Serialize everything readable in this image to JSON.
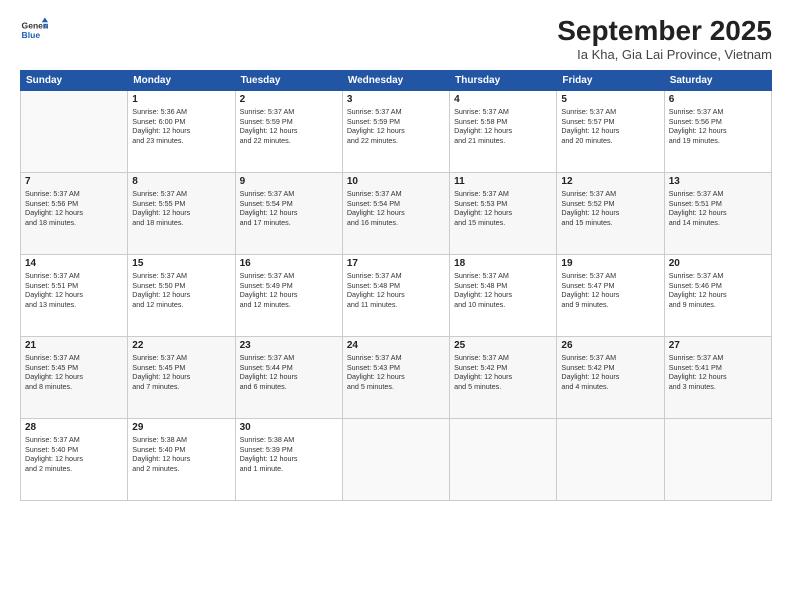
{
  "header": {
    "logo_line1": "General",
    "logo_line2": "Blue",
    "month": "September 2025",
    "location": "Ia Kha, Gia Lai Province, Vietnam"
  },
  "days_of_week": [
    "Sunday",
    "Monday",
    "Tuesday",
    "Wednesday",
    "Thursday",
    "Friday",
    "Saturday"
  ],
  "weeks": [
    [
      {
        "num": "",
        "info": ""
      },
      {
        "num": "1",
        "info": "Sunrise: 5:36 AM\nSunset: 6:00 PM\nDaylight: 12 hours\nand 23 minutes."
      },
      {
        "num": "2",
        "info": "Sunrise: 5:37 AM\nSunset: 5:59 PM\nDaylight: 12 hours\nand 22 minutes."
      },
      {
        "num": "3",
        "info": "Sunrise: 5:37 AM\nSunset: 5:59 PM\nDaylight: 12 hours\nand 22 minutes."
      },
      {
        "num": "4",
        "info": "Sunrise: 5:37 AM\nSunset: 5:58 PM\nDaylight: 12 hours\nand 21 minutes."
      },
      {
        "num": "5",
        "info": "Sunrise: 5:37 AM\nSunset: 5:57 PM\nDaylight: 12 hours\nand 20 minutes."
      },
      {
        "num": "6",
        "info": "Sunrise: 5:37 AM\nSunset: 5:56 PM\nDaylight: 12 hours\nand 19 minutes."
      }
    ],
    [
      {
        "num": "7",
        "info": "Sunrise: 5:37 AM\nSunset: 5:56 PM\nDaylight: 12 hours\nand 18 minutes."
      },
      {
        "num": "8",
        "info": "Sunrise: 5:37 AM\nSunset: 5:55 PM\nDaylight: 12 hours\nand 18 minutes."
      },
      {
        "num": "9",
        "info": "Sunrise: 5:37 AM\nSunset: 5:54 PM\nDaylight: 12 hours\nand 17 minutes."
      },
      {
        "num": "10",
        "info": "Sunrise: 5:37 AM\nSunset: 5:54 PM\nDaylight: 12 hours\nand 16 minutes."
      },
      {
        "num": "11",
        "info": "Sunrise: 5:37 AM\nSunset: 5:53 PM\nDaylight: 12 hours\nand 15 minutes."
      },
      {
        "num": "12",
        "info": "Sunrise: 5:37 AM\nSunset: 5:52 PM\nDaylight: 12 hours\nand 15 minutes."
      },
      {
        "num": "13",
        "info": "Sunrise: 5:37 AM\nSunset: 5:51 PM\nDaylight: 12 hours\nand 14 minutes."
      }
    ],
    [
      {
        "num": "14",
        "info": "Sunrise: 5:37 AM\nSunset: 5:51 PM\nDaylight: 12 hours\nand 13 minutes."
      },
      {
        "num": "15",
        "info": "Sunrise: 5:37 AM\nSunset: 5:50 PM\nDaylight: 12 hours\nand 12 minutes."
      },
      {
        "num": "16",
        "info": "Sunrise: 5:37 AM\nSunset: 5:49 PM\nDaylight: 12 hours\nand 12 minutes."
      },
      {
        "num": "17",
        "info": "Sunrise: 5:37 AM\nSunset: 5:48 PM\nDaylight: 12 hours\nand 11 minutes."
      },
      {
        "num": "18",
        "info": "Sunrise: 5:37 AM\nSunset: 5:48 PM\nDaylight: 12 hours\nand 10 minutes."
      },
      {
        "num": "19",
        "info": "Sunrise: 5:37 AM\nSunset: 5:47 PM\nDaylight: 12 hours\nand 9 minutes."
      },
      {
        "num": "20",
        "info": "Sunrise: 5:37 AM\nSunset: 5:46 PM\nDaylight: 12 hours\nand 9 minutes."
      }
    ],
    [
      {
        "num": "21",
        "info": "Sunrise: 5:37 AM\nSunset: 5:45 PM\nDaylight: 12 hours\nand 8 minutes."
      },
      {
        "num": "22",
        "info": "Sunrise: 5:37 AM\nSunset: 5:45 PM\nDaylight: 12 hours\nand 7 minutes."
      },
      {
        "num": "23",
        "info": "Sunrise: 5:37 AM\nSunset: 5:44 PM\nDaylight: 12 hours\nand 6 minutes."
      },
      {
        "num": "24",
        "info": "Sunrise: 5:37 AM\nSunset: 5:43 PM\nDaylight: 12 hours\nand 5 minutes."
      },
      {
        "num": "25",
        "info": "Sunrise: 5:37 AM\nSunset: 5:42 PM\nDaylight: 12 hours\nand 5 minutes."
      },
      {
        "num": "26",
        "info": "Sunrise: 5:37 AM\nSunset: 5:42 PM\nDaylight: 12 hours\nand 4 minutes."
      },
      {
        "num": "27",
        "info": "Sunrise: 5:37 AM\nSunset: 5:41 PM\nDaylight: 12 hours\nand 3 minutes."
      }
    ],
    [
      {
        "num": "28",
        "info": "Sunrise: 5:37 AM\nSunset: 5:40 PM\nDaylight: 12 hours\nand 2 minutes."
      },
      {
        "num": "29",
        "info": "Sunrise: 5:38 AM\nSunset: 5:40 PM\nDaylight: 12 hours\nand 2 minutes."
      },
      {
        "num": "30",
        "info": "Sunrise: 5:38 AM\nSunset: 5:39 PM\nDaylight: 12 hours\nand 1 minute."
      },
      {
        "num": "",
        "info": ""
      },
      {
        "num": "",
        "info": ""
      },
      {
        "num": "",
        "info": ""
      },
      {
        "num": "",
        "info": ""
      }
    ]
  ]
}
